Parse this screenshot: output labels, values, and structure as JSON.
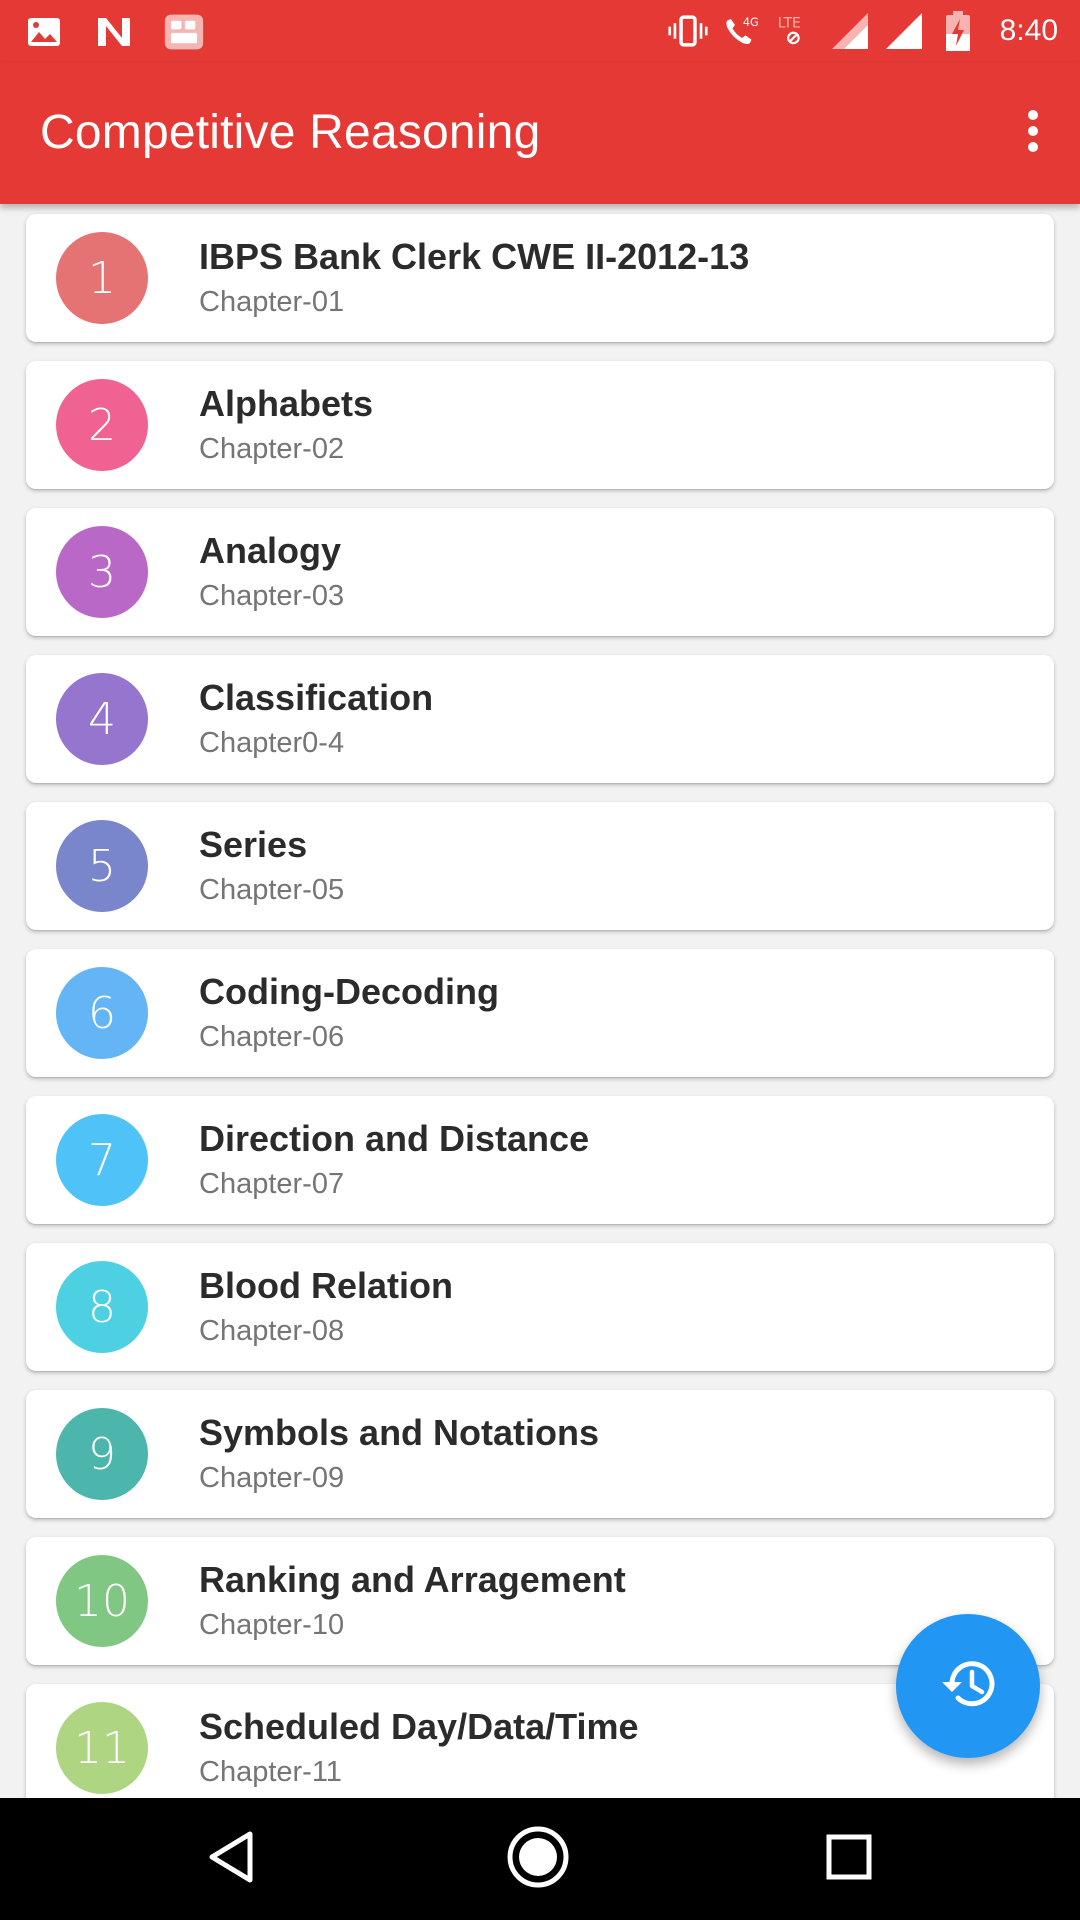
{
  "status_bar": {
    "time": "8:40",
    "left_icons": [
      "image-icon",
      "n-app-icon",
      "grid-app-icon"
    ],
    "right_icons": [
      "vibrate-icon",
      "call-4g-icon",
      "lte-icon",
      "signal-icon",
      "signal-full-icon",
      "battery-charging-icon"
    ]
  },
  "app_bar": {
    "title": "Competitive Reasoning",
    "menu_icon": "more-vert-icon"
  },
  "chapters": [
    {
      "number": "1",
      "title": "IBPS Bank Clerk CWE II-2012-13",
      "subtitle": "Chapter-01",
      "color": "#e57373"
    },
    {
      "number": "2",
      "title": "Alphabets",
      "subtitle": "Chapter-02",
      "color": "#f06292"
    },
    {
      "number": "3",
      "title": "Analogy",
      "subtitle": "Chapter-03",
      "color": "#ba68c8"
    },
    {
      "number": "4",
      "title": "Classification",
      "subtitle": "Chapter0-4",
      "color": "#9575cd"
    },
    {
      "number": "5",
      "title": "Series",
      "subtitle": "Chapter-05",
      "color": "#7986cb"
    },
    {
      "number": "6",
      "title": "Coding-Decoding",
      "subtitle": "Chapter-06",
      "color": "#64b5f6"
    },
    {
      "number": "7",
      "title": "Direction and Distance",
      "subtitle": "Chapter-07",
      "color": "#4fc3f7"
    },
    {
      "number": "8",
      "title": "Blood Relation",
      "subtitle": "Chapter-08",
      "color": "#4dd0e1"
    },
    {
      "number": "9",
      "title": "Symbols and Notations",
      "subtitle": "Chapter-09",
      "color": "#4db6ac"
    },
    {
      "number": "10",
      "title": "Ranking and Arragement",
      "subtitle": "Chapter-10",
      "color": "#81c784"
    },
    {
      "number": "11",
      "title": "Scheduled Day/Data/Time",
      "subtitle": "Chapter-11",
      "color": "#aed581"
    }
  ],
  "fab": {
    "icon": "history-icon",
    "color": "#2196f3"
  },
  "nav_bar": {
    "icons": [
      "back-icon",
      "home-icon",
      "recents-icon"
    ]
  },
  "colors": {
    "primary": "#e53935"
  }
}
